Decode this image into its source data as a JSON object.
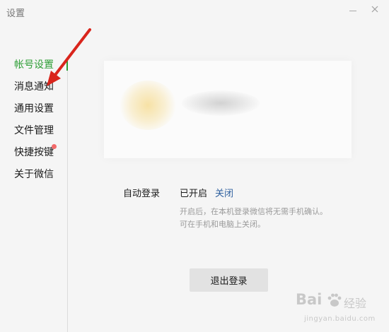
{
  "window": {
    "title": "设置"
  },
  "sidebar": {
    "items": [
      {
        "label": "帐号设置",
        "active": true
      },
      {
        "label": "消息通知"
      },
      {
        "label": "通用设置"
      },
      {
        "label": "文件管理"
      },
      {
        "label": "快捷按键",
        "has_badge": true
      },
      {
        "label": "关于微信"
      }
    ]
  },
  "account": {
    "auto_login": {
      "label": "自动登录",
      "status": "已开启",
      "toggle_label": "关闭",
      "hint_line1": "开启后，在本机登录微信将无需手机确认。",
      "hint_line2": "可在手机和电脑上关闭。"
    },
    "logout_label": "退出登录"
  },
  "watermark": {
    "brand": "Bai",
    "suffix": "经验",
    "url": "jingyan.baidu.com"
  },
  "colors": {
    "accent_green": "#2e9e36",
    "link_blue": "#2d5f9e",
    "annotation_red": "#d9251c",
    "badge_red": "#f26a6a",
    "background": "#f5f5f5"
  },
  "icons": {
    "close": "close-icon",
    "minimize": "minimize-icon",
    "annotation": "annotation-arrow",
    "watermark_logo": "paw-icon"
  }
}
